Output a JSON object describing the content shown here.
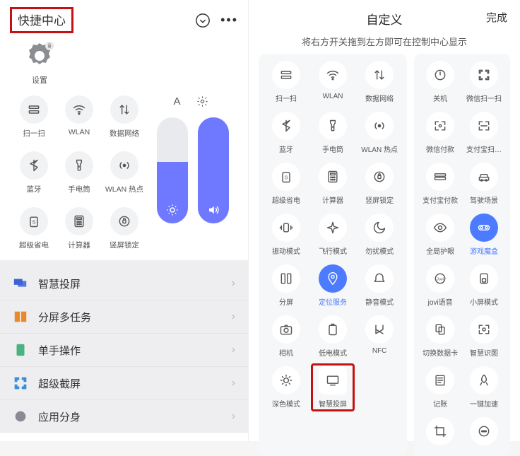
{
  "left": {
    "title": "快捷中心",
    "settings_label": "设置",
    "qs": [
      {
        "name": "scan-icon",
        "label": "扫一扫"
      },
      {
        "name": "wifi-icon",
        "label": "WLAN"
      },
      {
        "name": "data-icon",
        "label": "数据网络"
      },
      {
        "name": "bluetooth-icon",
        "label": "蓝牙"
      },
      {
        "name": "flashlight-icon",
        "label": "手电筒"
      },
      {
        "name": "hotspot-icon",
        "label": "WLAN 热点"
      },
      {
        "name": "battery-icon",
        "label": "超级省电"
      },
      {
        "name": "calculator-icon",
        "label": "计算器"
      },
      {
        "name": "lock-rotation-icon",
        "label": "竖屏锁定"
      }
    ],
    "menu": [
      {
        "label": "智慧投屏",
        "color": "#3a63d6"
      },
      {
        "label": "分屏多任务",
        "color": "#e98a2a"
      },
      {
        "label": "单手操作",
        "color": "#49b282"
      },
      {
        "label": "超级截屏",
        "color": "#3a8dd6"
      },
      {
        "label": "应用分身",
        "color": "#8a8a95"
      }
    ]
  },
  "right": {
    "title": "自定义",
    "action": "完成",
    "hint": "将右方开关拖到左方即可在控制中心显示",
    "left_col": [
      {
        "name": "scan-icon",
        "label": "扫一扫"
      },
      {
        "name": "wifi-icon",
        "label": "WLAN"
      },
      {
        "name": "data-icon",
        "label": "数据网络"
      },
      {
        "name": "bluetooth-icon",
        "label": "蓝牙"
      },
      {
        "name": "flashlight-icon",
        "label": "手电筒"
      },
      {
        "name": "hotspot-icon",
        "label": "WLAN 热点"
      },
      {
        "name": "battery-icon",
        "label": "超级省电"
      },
      {
        "name": "calculator-icon",
        "label": "计算器"
      },
      {
        "name": "lock-rotation-icon",
        "label": "竖屏锁定"
      },
      {
        "name": "vibrate-icon",
        "label": "振动模式"
      },
      {
        "name": "airplane-icon",
        "label": "飞行模式"
      },
      {
        "name": "dnd-icon",
        "label": "勿扰模式"
      },
      {
        "name": "split-icon",
        "label": "分屏"
      },
      {
        "name": "location-icon",
        "label": "定位服务",
        "active": true
      },
      {
        "name": "mute-icon",
        "label": "静音模式"
      },
      {
        "name": "camera-icon",
        "label": "相机"
      },
      {
        "name": "lowbatt-icon",
        "label": "低电模式"
      },
      {
        "name": "nfc-icon",
        "label": "NFC"
      },
      {
        "name": "dark-icon",
        "label": "深色模式"
      },
      {
        "name": "cast-icon",
        "label": "智慧投屏",
        "boxed": true
      }
    ],
    "right_col": [
      {
        "name": "power-icon",
        "label": "关机"
      },
      {
        "name": "wxscan-icon",
        "label": "微信扫一扫"
      },
      {
        "name": "wxpay-icon",
        "label": "微信付款"
      },
      {
        "name": "alipay-scan-icon",
        "label": "支付宝扫…"
      },
      {
        "name": "alipay-pay-icon",
        "label": "支付宝付款"
      },
      {
        "name": "drive-icon",
        "label": "驾驶场景"
      },
      {
        "name": "eye-icon",
        "label": "全局护眼"
      },
      {
        "name": "gamebox-icon",
        "label": "游戏魔盒",
        "active": true
      },
      {
        "name": "jovi-icon",
        "label": "jovi语音"
      },
      {
        "name": "small-icon",
        "label": "小屏模式"
      },
      {
        "name": "simswap-icon",
        "label": "切换数据卡"
      },
      {
        "name": "vision-icon",
        "label": "智慧识图"
      },
      {
        "name": "ledger-icon",
        "label": "记账"
      },
      {
        "name": "rocket-icon",
        "label": "一键加速"
      },
      {
        "name": "crop-icon",
        "label": ""
      },
      {
        "name": "dots-icon",
        "label": ""
      }
    ]
  }
}
